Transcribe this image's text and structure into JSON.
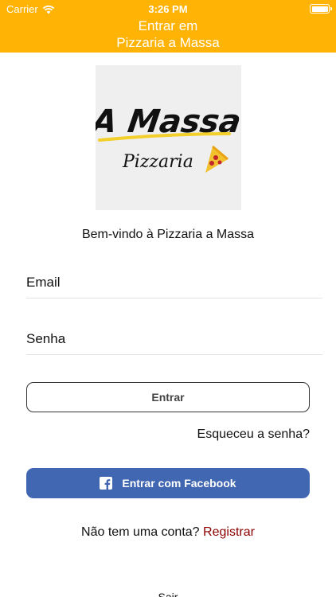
{
  "status_bar": {
    "carrier": "Carrier",
    "time": "3:26 PM",
    "wifi_icon": "wifi-icon",
    "battery_icon": "battery-icon"
  },
  "header": {
    "title_line1": "Entrar em",
    "title_line2": "Pizzaria a Massa",
    "background": "#FFB305"
  },
  "logo": {
    "text_main": "A Massa",
    "text_sub": "Pizzaria"
  },
  "welcome": "Bem-vindo à Pizzaria a Massa",
  "form": {
    "email_placeholder": "Email",
    "password_placeholder": "Senha"
  },
  "buttons": {
    "login": "Entrar",
    "forgot": "Esqueceu a senha?",
    "facebook": "Entrar com Facebook",
    "facebook_color": "#4267B2"
  },
  "register": {
    "prompt": "Não tem uma conta?",
    "link": "Registrar",
    "link_color": "#8B0000"
  },
  "footer": {
    "exit": "Sair"
  }
}
